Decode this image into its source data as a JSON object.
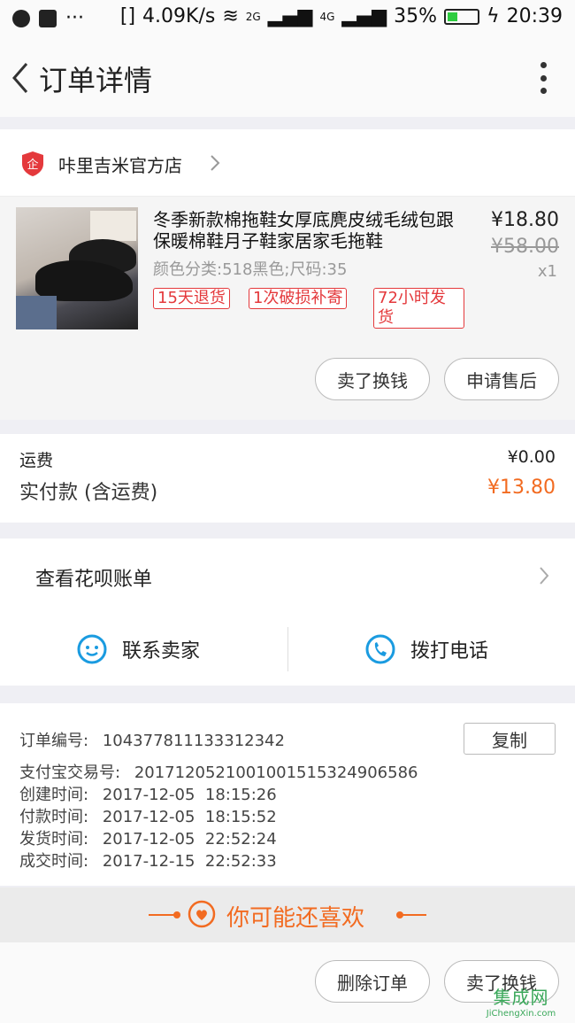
{
  "status_bar": {
    "net_speed": "4.09K/s",
    "sim1_label": "2G",
    "sim2_label": "4G",
    "battery": "35%",
    "battery_level": 0.35,
    "time": "20:39"
  },
  "header": {
    "title": "订单详情"
  },
  "shop": {
    "name": "咔里吉米官方店",
    "badge_char": "企"
  },
  "item": {
    "title": "冬季新款棉拖鞋女厚底麂皮绒毛绒包跟保暖棉鞋月子鞋家居家毛拖鞋",
    "sku": "颜色分类:518黑色;尺码:35",
    "tags": [
      "15天退货",
      "1次破损补寄",
      "72小时发货"
    ],
    "price": "¥18.80",
    "original_price": "¥58.00",
    "quantity": "x1",
    "buttons": [
      "卖了换钱",
      "申请售后"
    ]
  },
  "fees": {
    "shipping_label": "运费",
    "shipping_value": "¥0.00",
    "paid_label": "实付款 (含运费)",
    "paid_value": "¥13.80"
  },
  "huabei": {
    "label": "查看花呗账单"
  },
  "contact": {
    "seller_label": "联系卖家",
    "phone_label": "拨打电话"
  },
  "order_info": {
    "order_no_label": "订单编号:",
    "order_no": "104377811133312342",
    "copy_label": "复制",
    "alipay_label": "支付宝交易号:",
    "alipay_no": "2017120521001001515324906586",
    "created_label": "创建时间:",
    "created_time": "2017-12-05  18:15:26",
    "paid_label": "付款时间:",
    "paid_time": "2017-12-05  18:15:52",
    "shipped_label": "发货时间:",
    "shipped_time": "2017-12-05  22:52:24",
    "done_label": "成交时间:",
    "done_time": "2017-12-15  22:52:33"
  },
  "recommend": {
    "label": "你可能还喜欢"
  },
  "bottom_actions": {
    "delete_label": "删除订单",
    "sell_label": "卖了换钱"
  },
  "watermark": {
    "main": "集成网",
    "sub": "JiChengXin.com"
  },
  "colors": {
    "accent": "#f26b21",
    "tag_red": "#e4393c",
    "icon_blue": "#1a9be0"
  }
}
